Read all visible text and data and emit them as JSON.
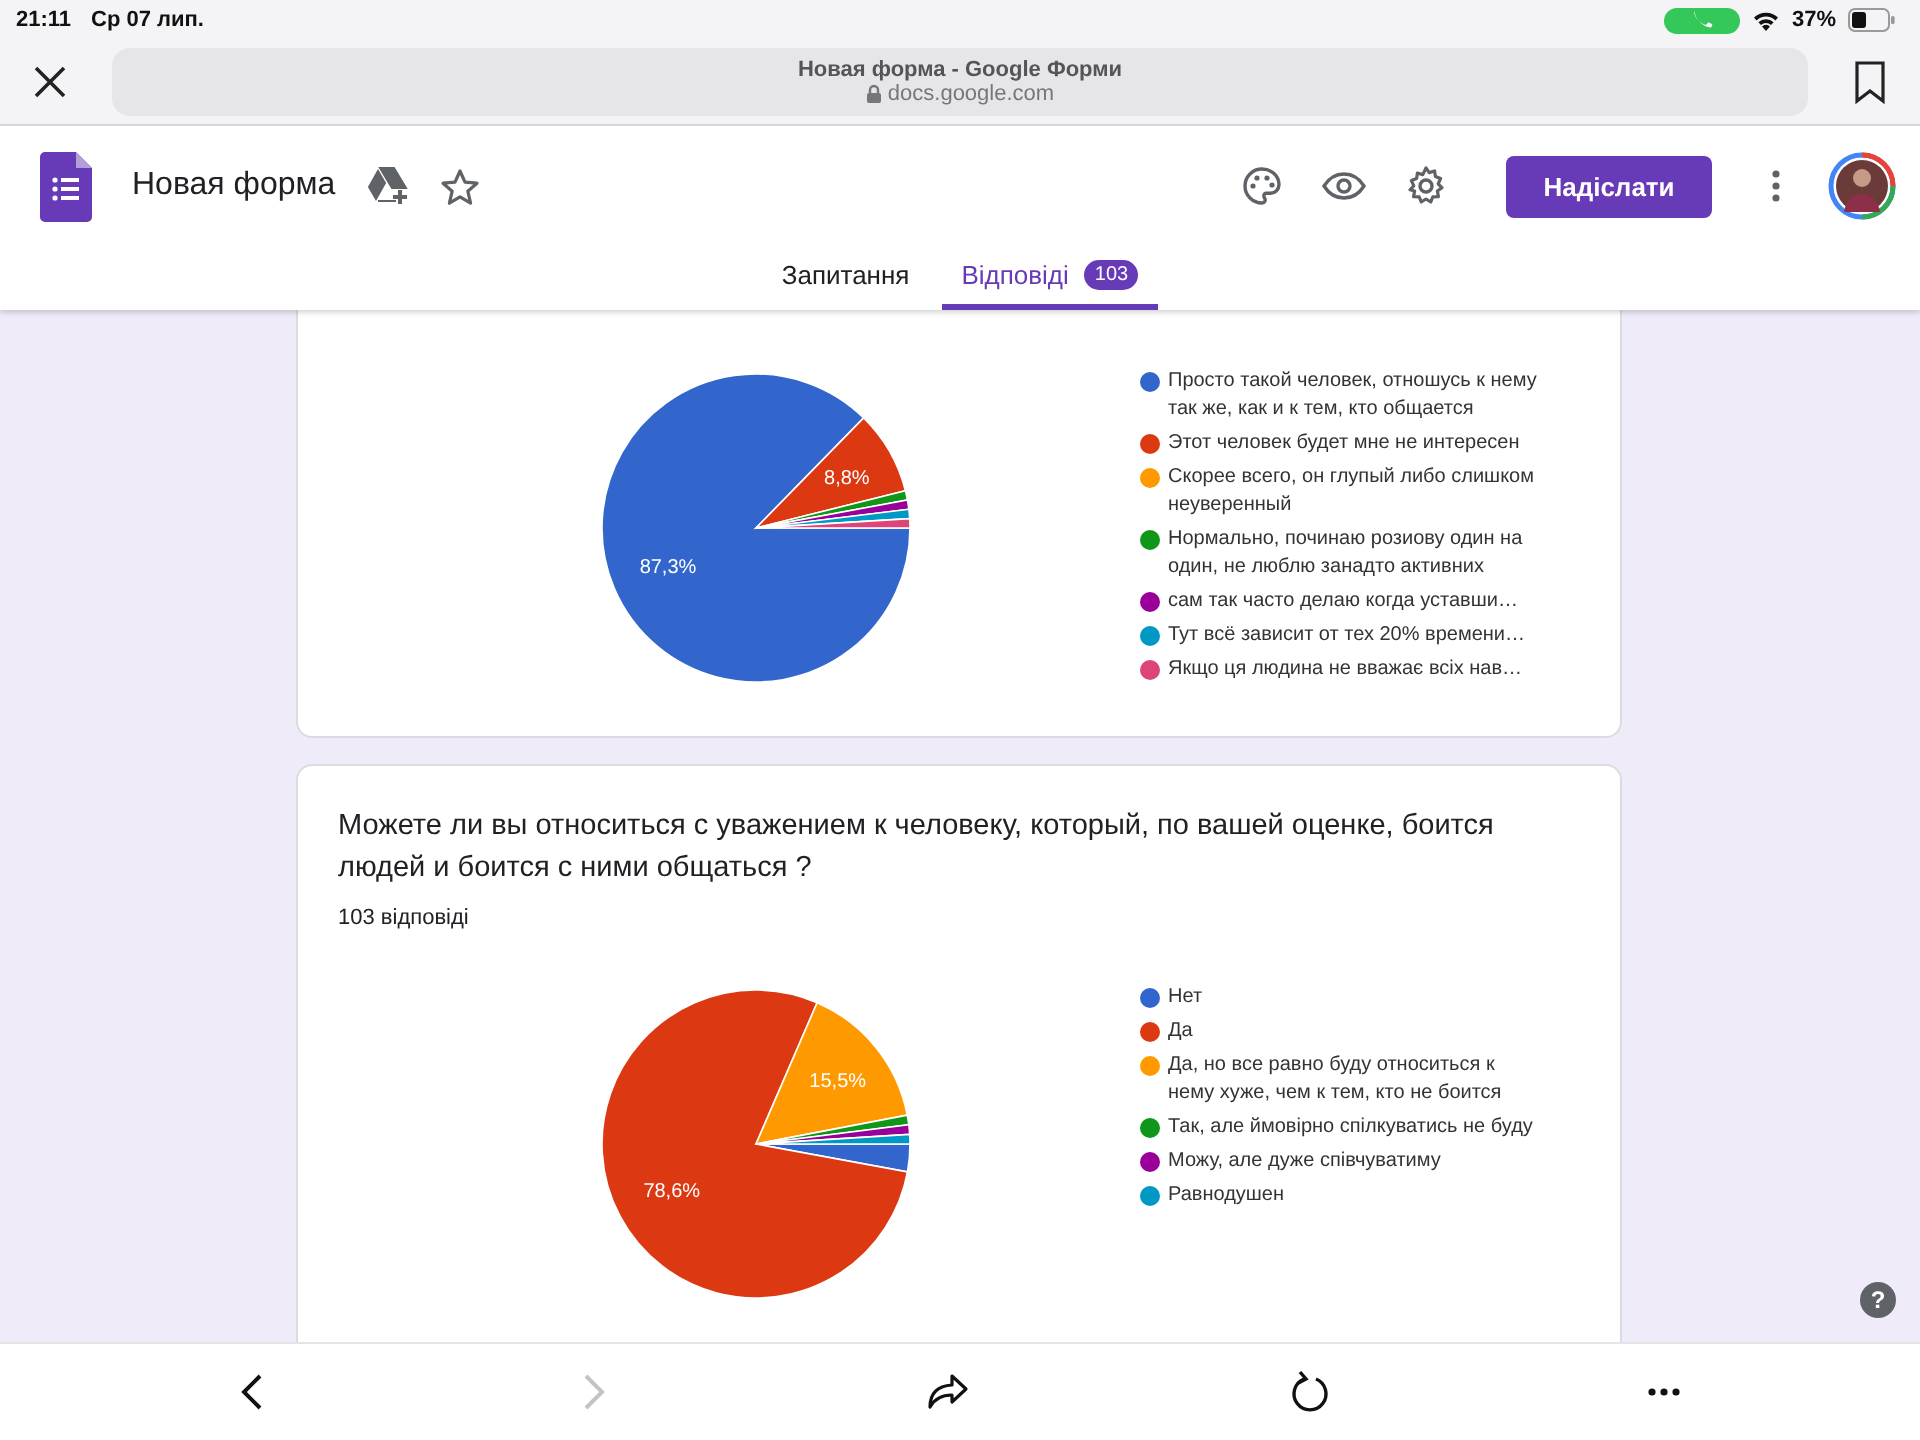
{
  "status_bar": {
    "time": "21:11",
    "date": "Ср 07 лип.",
    "battery": "37%"
  },
  "browser": {
    "page_title": "Новая форма - Google Форми",
    "url": "docs.google.com"
  },
  "header": {
    "form_title": "Новая форма",
    "send_button": "Надіслати"
  },
  "tabs": [
    {
      "label": "Запитання",
      "selected": false
    },
    {
      "label": "Відповіді",
      "selected": true,
      "badge": "103"
    }
  ],
  "questions": [
    {
      "chart_data": {
        "type": "pie",
        "categories": [
          "Просто такой человек, отношусь к нему так же, как и к тем, кто общается",
          "Этот человек будет мне не интересен",
          "Скорее всего, он глупый либо слишком неуверенный",
          "Нормально, починаю розиову один на один, не люблю занадто активних",
          "сам так часто делаю когда уставши…",
          "Тут всё зависит от тех 20% времени…",
          "Якщо ця людина не вважає всіх нав…"
        ],
        "values": [
          87.3,
          8.8,
          0,
          0.97,
          0.97,
          0.97,
          0.97
        ],
        "legend": "right",
        "colors": [
          "#3366cc",
          "#dc3912",
          "#ff9900",
          "#109618",
          "#990099",
          "#0099c6",
          "#dd4477"
        ],
        "value_labels": [
          "87,3%",
          "8,8%",
          null,
          null,
          null,
          null,
          null
        ]
      }
    },
    {
      "title": "Можете ли вы относиться с уважением к человеку, который, по вашей оценке, боится людей и боится с ними общаться ?",
      "count": "103 відповіді",
      "chart_data": {
        "type": "pie",
        "categories": [
          "Нет",
          "Да",
          "Да, но все равно буду относиться к нему хуже, чем к тем, кто не боится",
          "Так, але ймовірно спілкуватись не буду",
          "Можу, але дуже співчуватиму",
          "Равнодушен"
        ],
        "values": [
          2.9,
          78.6,
          15.5,
          1,
          1,
          1
        ],
        "legend": "right",
        "colors": [
          "#3366cc",
          "#dc3912",
          "#ff9900",
          "#109618",
          "#990099",
          "#0099c6"
        ],
        "value_labels": [
          null,
          "78,6%",
          "15,5%",
          null,
          null,
          null
        ]
      }
    }
  ],
  "toolbar": {
    "forward_disabled": true
  },
  "help": "?"
}
